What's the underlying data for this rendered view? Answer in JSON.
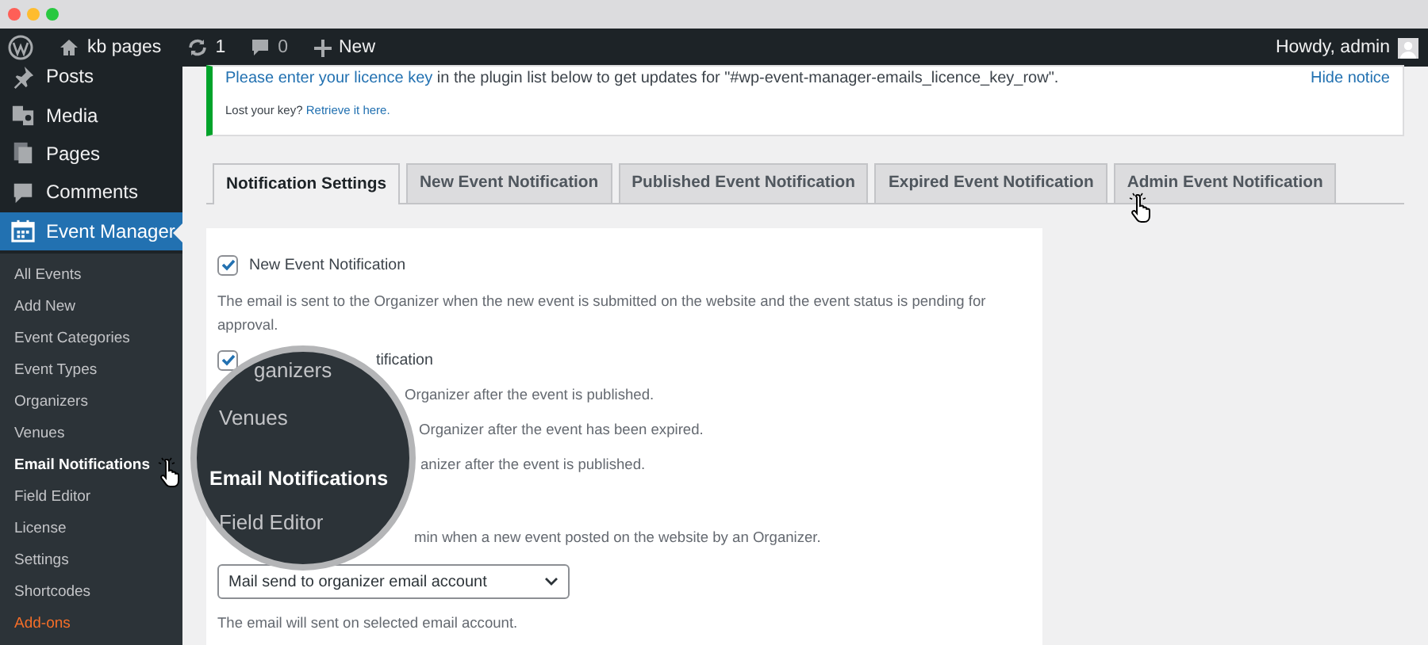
{
  "admin_bar": {
    "site": "kb pages",
    "updates": "1",
    "comments": "0",
    "new": "New",
    "greeting": "Howdy, admin"
  },
  "sidebar": {
    "items": [
      {
        "label": "Posts",
        "selected": false
      },
      {
        "label": "Media",
        "selected": false
      },
      {
        "label": "Pages",
        "selected": false
      },
      {
        "label": "Comments",
        "selected": false
      },
      {
        "label": "Event Manager",
        "selected": true
      }
    ],
    "submenu": [
      {
        "label": "All Events",
        "selected": false,
        "kind": "link"
      },
      {
        "label": "Add New",
        "selected": false,
        "kind": "link"
      },
      {
        "label": "Event Categories",
        "selected": false,
        "kind": "link"
      },
      {
        "label": "Event Types",
        "selected": false,
        "kind": "link"
      },
      {
        "label": "Organizers",
        "selected": false,
        "kind": "link"
      },
      {
        "label": "Venues",
        "selected": false,
        "kind": "link"
      },
      {
        "label": "Email Notifications",
        "selected": true,
        "kind": "link"
      },
      {
        "label": "Field Editor",
        "selected": false,
        "kind": "link"
      },
      {
        "label": "License",
        "selected": false,
        "kind": "link"
      },
      {
        "label": "Settings",
        "selected": false,
        "kind": "link"
      },
      {
        "label": "Shortcodes",
        "selected": false,
        "kind": "link"
      },
      {
        "label": "Add-ons",
        "selected": false,
        "kind": "addon"
      }
    ]
  },
  "notice": {
    "link": "Please enter your licence key",
    "text": " in the plugin list below to get updates for \"#wp-event-manager-emails_licence_key_row\".",
    "lost": "Lost your key?",
    "retrieve": "Retrieve it here.",
    "hide": "Hide notice"
  },
  "tabs": [
    {
      "label": "Notification Settings",
      "selected": true
    },
    {
      "label": "New Event Notification",
      "selected": false
    },
    {
      "label": "Published Event Notification",
      "selected": false
    },
    {
      "label": "Expired Event Notification",
      "selected": false
    },
    {
      "label": "Admin Event Notification",
      "selected": false
    }
  ],
  "settings": [
    {
      "kind": "checkbox",
      "label": "New Event Notification",
      "checked": true
    },
    {
      "kind": "text",
      "text": "The email is sent to the Organizer when the new event is submitted on the website and the event status is pending for approval."
    },
    {
      "kind": "partial_checkbox",
      "label": "tification",
      "checked": true
    },
    {
      "kind": "partial",
      "text": "Organizer after the event is published."
    },
    {
      "kind": "partial",
      "text": "Organizer after the event has been expired."
    },
    {
      "kind": "partial",
      "text": "anizer after the event is published."
    },
    {
      "kind": "partial",
      "text": "min when a new event posted on the website by an Organizer."
    },
    {
      "kind": "select",
      "value": "Mail send to organizer email account"
    },
    {
      "kind": "text",
      "text": "The email will sent on selected email account."
    }
  ],
  "magnifier": {
    "items": [
      {
        "label": "ganizers",
        "selected": false
      },
      {
        "label": "Venues",
        "selected": false
      },
      {
        "label": "Email Notifications",
        "selected": true
      },
      {
        "label": "Field Editor",
        "selected": false
      }
    ]
  }
}
